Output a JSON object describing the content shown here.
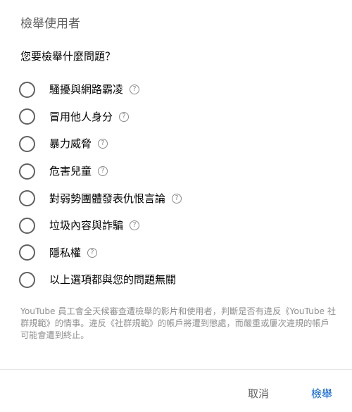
{
  "dialog": {
    "title": "檢舉使用者",
    "question": "您要檢舉什麼問題？",
    "options": [
      {
        "label": "騷擾與網路霸凌",
        "has_help": true
      },
      {
        "label": "冒用他人身分",
        "has_help": true
      },
      {
        "label": "暴力威脅",
        "has_help": true
      },
      {
        "label": "危害兒童",
        "has_help": true
      },
      {
        "label": "對弱勢團體發表仇恨言論",
        "has_help": true
      },
      {
        "label": "垃圾內容與詐騙",
        "has_help": true
      },
      {
        "label": "隱私權",
        "has_help": true
      },
      {
        "label": "以上選項都與您的問題無關",
        "has_help": false
      }
    ],
    "help_glyph": "?",
    "disclaimer": "YouTube 員工會全天候審查遭檢舉的影片和使用者，判斷是否有違反《YouTube 社群規範》的情事。違反《社群規範》的帳戶將遭到懲處，而嚴重或屢次違規的帳戶可能會遭到終止。",
    "cancel_label": "取消",
    "report_label": "檢舉"
  },
  "colors": {
    "accent": "#065fd4",
    "text": "#030303",
    "secondary_text": "#606060",
    "muted_text": "#909090"
  },
  "icons": {
    "radio": "radio-unchecked-icon",
    "help": "help-circle-icon"
  }
}
